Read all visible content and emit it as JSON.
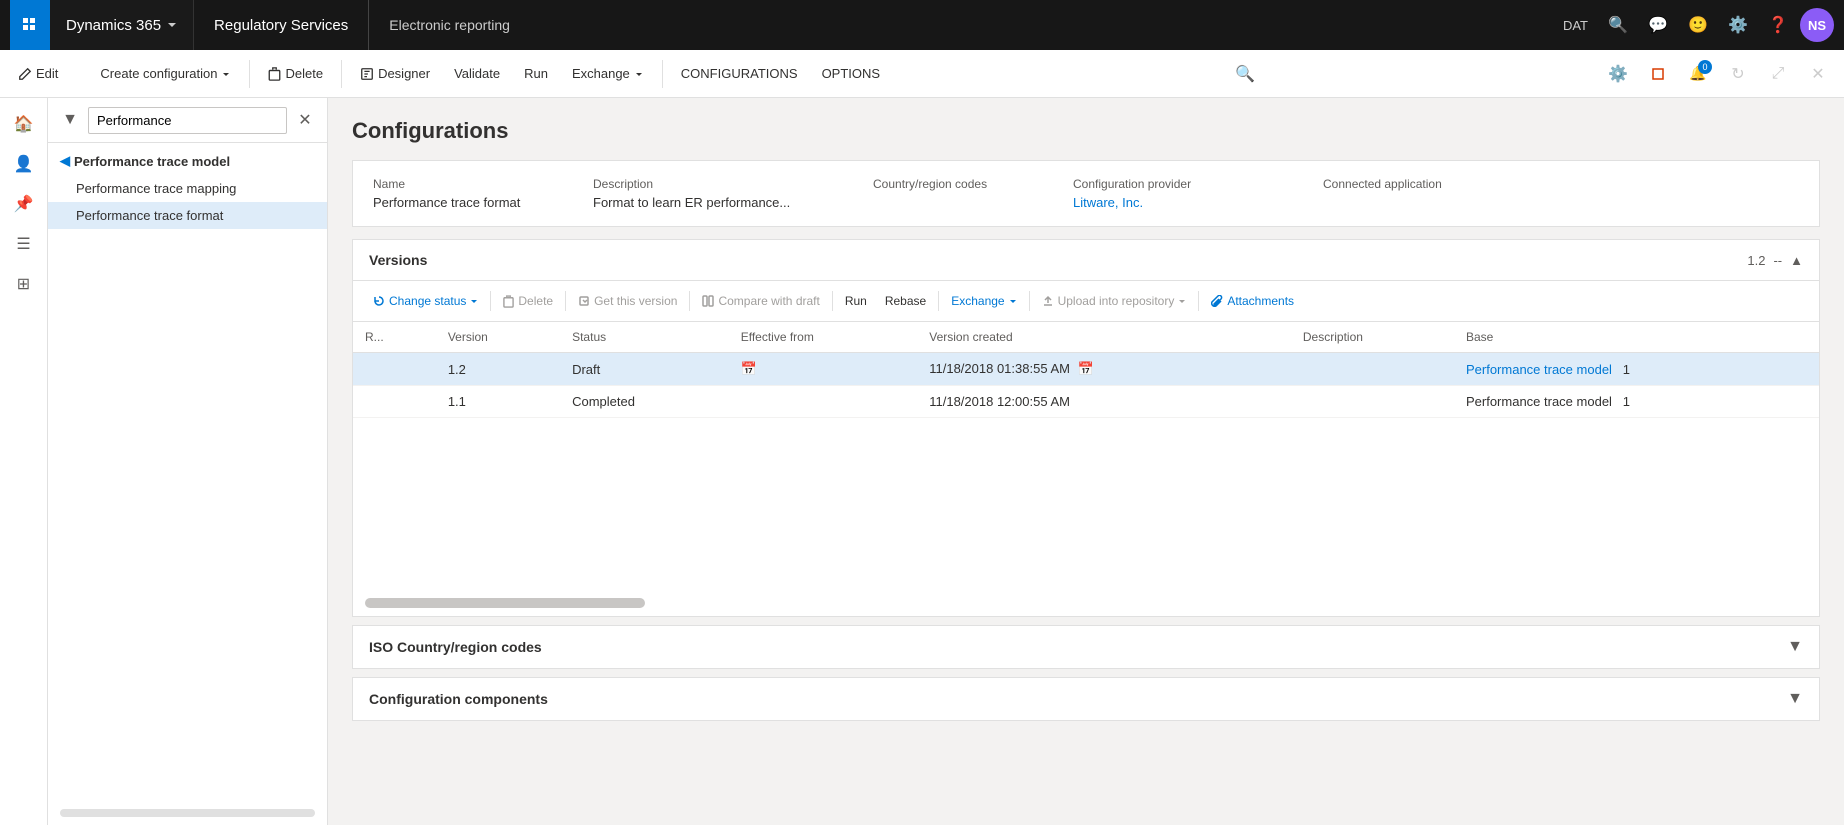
{
  "topnav": {
    "dynamics_label": "Dynamics 365",
    "reg_services_label": "Regulatory Services",
    "er_title": "Electronic reporting",
    "dat_label": "DAT",
    "avatar_initials": "NS",
    "badge_count": "0"
  },
  "commandbar": {
    "edit_label": "Edit",
    "create_config_label": "Create configuration",
    "delete_label": "Delete",
    "designer_label": "Designer",
    "validate_label": "Validate",
    "run_label": "Run",
    "exchange_label": "Exchange",
    "configurations_label": "CONFIGURATIONS",
    "options_label": "OPTIONS"
  },
  "tree": {
    "search_placeholder": "Performance",
    "parent_item": "Performance trace model",
    "child1": "Performance trace mapping",
    "child2": "Performance trace format"
  },
  "content": {
    "page_title": "Configurations",
    "config": {
      "name_label": "Name",
      "description_label": "Description",
      "country_label": "Country/region codes",
      "provider_label": "Configuration provider",
      "connected_label": "Connected application",
      "name_value": "Performance trace format",
      "description_value": "Format to learn ER performance...",
      "provider_value": "Litware, Inc."
    },
    "versions": {
      "panel_title": "Versions",
      "version_num": "1.2",
      "version_sep": "--",
      "toolbar": {
        "change_status": "Change status",
        "delete": "Delete",
        "get_version": "Get this version",
        "compare_draft": "Compare with draft",
        "run": "Run",
        "rebase": "Rebase",
        "exchange": "Exchange",
        "upload": "Upload into repository",
        "attachments": "Attachments"
      },
      "columns": {
        "r": "R...",
        "version": "Version",
        "status": "Status",
        "effective_from": "Effective from",
        "version_created": "Version created",
        "description": "Description",
        "base": "Base"
      },
      "rows": [
        {
          "r": "",
          "version": "1.2",
          "status": "Draft",
          "effective_from": "",
          "version_created": "11/18/2018 01:38:55 AM",
          "description": "",
          "base_name": "Performance trace model",
          "base_num": "1",
          "selected": true
        },
        {
          "r": "",
          "version": "1.1",
          "status": "Completed",
          "effective_from": "",
          "version_created": "11/18/2018 12:00:55 AM",
          "description": "",
          "base_name": "Performance trace model",
          "base_num": "1",
          "selected": false
        }
      ]
    },
    "iso_panel": {
      "title": "ISO Country/region codes"
    },
    "components_panel": {
      "title": "Configuration components"
    }
  }
}
